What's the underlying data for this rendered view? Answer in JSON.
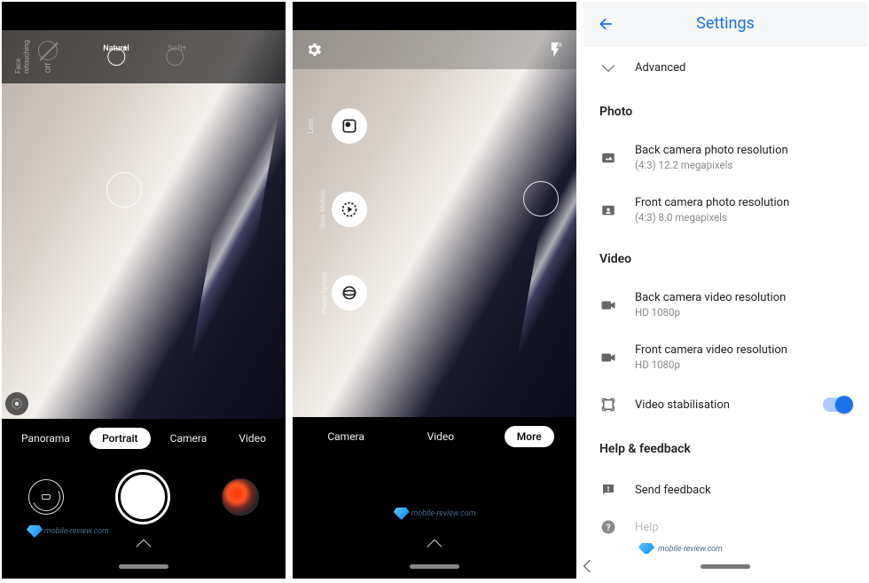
{
  "screen1": {
    "face_retouching_label_line1": "Face",
    "face_retouching_label_line2": "retouching",
    "face_retouching_state": "Off",
    "retouch_options": {
      "natural": "Natural",
      "soft": "Soft"
    },
    "modes": {
      "panorama": "Panorama",
      "portrait": "Portrait",
      "camera": "Camera",
      "video": "Video"
    },
    "active_mode": "Portrait",
    "watermark": "mobile-review.com"
  },
  "screen2": {
    "modes": {
      "camera": "Camera",
      "video": "Video",
      "more": "More"
    },
    "active_mode": "More",
    "side_items": {
      "lens": "Lens",
      "slowmo": "Slow Motion",
      "photosphere": "Photo Sphere"
    },
    "watermark": "mobile-review.com"
  },
  "screen3": {
    "title": "Settings",
    "advanced": "Advanced",
    "sections": {
      "photo": "Photo",
      "video": "Video",
      "help": "Help & feedback"
    },
    "items": {
      "back_photo": {
        "primary": "Back camera photo resolution",
        "secondary": "(4:3) 12.2 megapixels"
      },
      "front_photo": {
        "primary": "Front camera photo resolution",
        "secondary": "(4:3) 8.0 megapixels"
      },
      "back_video": {
        "primary": "Back camera video resolution",
        "secondary": "HD 1080p"
      },
      "front_video": {
        "primary": "Front camera video resolution",
        "secondary": "HD 1080p"
      },
      "stabilisation": {
        "primary": "Video stabilisation"
      },
      "send_feedback": {
        "primary": "Send feedback"
      },
      "help": {
        "primary": "Help"
      }
    },
    "stabilisation_on": true,
    "watermark": "mobile-review.com"
  }
}
